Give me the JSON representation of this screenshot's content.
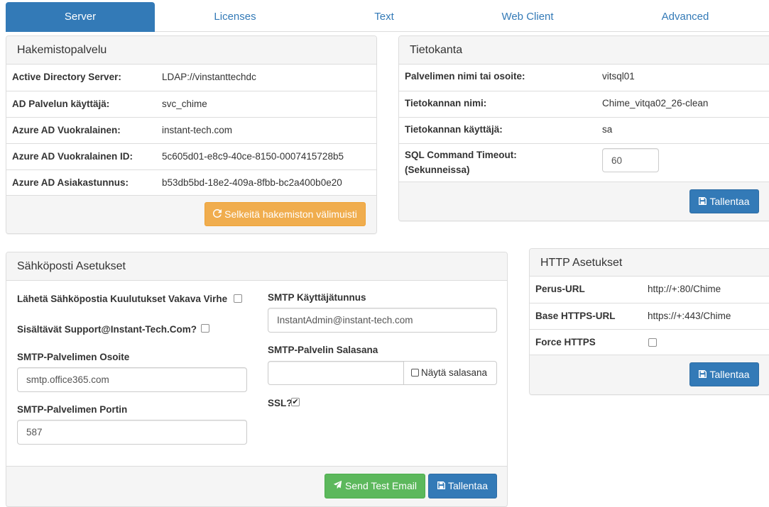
{
  "tabs": [
    "Server",
    "Licenses",
    "Text",
    "Web Client",
    "Advanced"
  ],
  "directory": {
    "title": "Hakemistopalvelu",
    "rows": [
      {
        "label": "Active Directory Server:",
        "value": "LDAP://vinstanttechdc"
      },
      {
        "label": "AD Palvelun käyttäjä:",
        "value": "svc_chime"
      },
      {
        "label": "Azure AD Vuokralainen:",
        "value": "instant-tech.com"
      },
      {
        "label": "Azure AD Vuokralainen ID:",
        "value": "5c605d01-e8c9-40ce-8150-0007415728b5"
      },
      {
        "label": "Azure AD Asiakastunnus:",
        "value": "b53db5bd-18e2-409a-8fbb-bc2a400b0e20"
      }
    ],
    "clear_cache_label": "Selkeitä hakemiston välimuisti"
  },
  "database": {
    "title": "Tietokanta",
    "rows": [
      {
        "label": "Palvelimen nimi tai osoite:",
        "value": "vitsql01"
      },
      {
        "label": "Tietokannan nimi:",
        "value": "Chime_vitqa02_26-clean"
      },
      {
        "label": "Tietokannan käyttäjä:",
        "value": "sa"
      }
    ],
    "timeout_label_1": "SQL Command Timeout:",
    "timeout_label_2": "(Sekunneissa)",
    "timeout_value": "60",
    "save_label": "Tallentaa"
  },
  "email": {
    "title": "Sähköposti Asetukset",
    "notify_label": "Lähetä Sähköpostia Kuulutukset Vakava Virhe",
    "notify_checked": false,
    "include_support_label": "Sisältävät Support@Instant-Tech.Com?",
    "include_support_checked": false,
    "smtp_server_label": "SMTP-Palvelimen Osoite",
    "smtp_server_value": "smtp.office365.com",
    "smtp_port_label": "SMTP-Palvelimen Portin",
    "smtp_port_value": "587",
    "smtp_user_label": "SMTP Käyttäjätunnus",
    "smtp_user_value": "InstantAdmin@instant-tech.com",
    "smtp_password_label": "SMTP-Palvelin Salasana",
    "smtp_password_value": "",
    "show_password_label": "Näytä salasana",
    "ssl_label": "SSL?",
    "ssl_checked": true,
    "send_test_label": "Send Test Email",
    "save_label": "Tallentaa"
  },
  "http": {
    "title": "HTTP Asetukset",
    "rows": [
      {
        "label": "Perus-URL",
        "value": "http://+:80/Chime"
      },
      {
        "label": "Base HTTPS-URL",
        "value": "https://+:443/Chime"
      }
    ],
    "force_https_label": "Force HTTPS",
    "force_https_checked": false,
    "save_label": "Tallentaa"
  },
  "colors": {
    "primary": "#337ab7",
    "warning": "#f0ad4e",
    "success": "#5cb85c",
    "panel_heading": "#f5f5f5"
  },
  "icons": {
    "save": "floppy-disk-icon",
    "refresh": "refresh-icon",
    "send": "paper-plane-icon"
  }
}
